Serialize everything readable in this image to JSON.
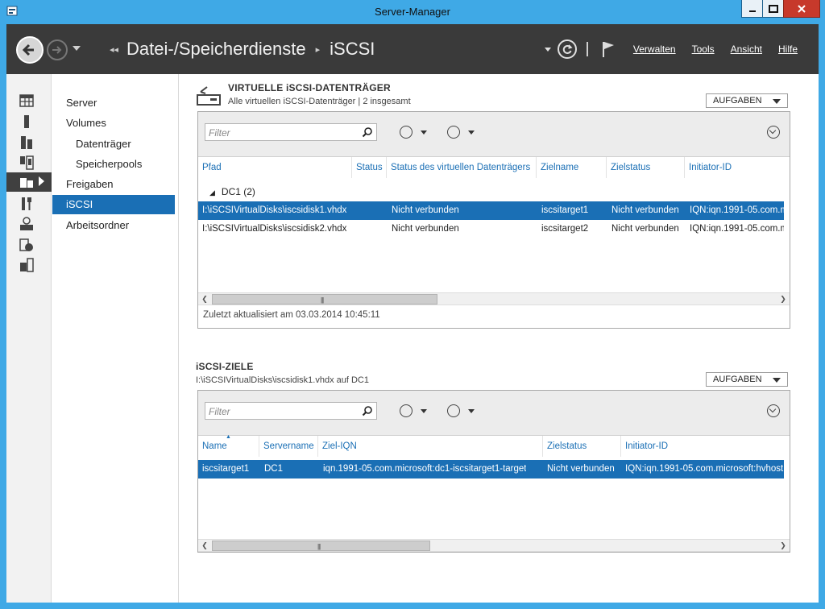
{
  "window": {
    "title": "Server-Manager"
  },
  "header": {
    "breadcrumb": [
      "Datei-/Speicherdienste",
      "iSCSI"
    ],
    "menu": [
      "Verwalten",
      "Tools",
      "Ansicht",
      "Hilfe"
    ]
  },
  "nav": {
    "items": [
      {
        "label": "Server",
        "sub": false,
        "selected": false
      },
      {
        "label": "Volumes",
        "sub": false,
        "selected": false
      },
      {
        "label": "Datenträger",
        "sub": true,
        "selected": false
      },
      {
        "label": "Speicherpools",
        "sub": true,
        "selected": false
      },
      {
        "label": "Freigaben",
        "sub": false,
        "selected": false
      },
      {
        "label": "iSCSI",
        "sub": false,
        "selected": true
      },
      {
        "label": "Arbeitsordner",
        "sub": false,
        "selected": false
      }
    ]
  },
  "disks": {
    "title": "VIRTUELLE iSCSI-DATENTRÄGER",
    "subtitle": "Alle virtuellen iSCSI-Datenträger | 2 insgesamt",
    "tasks_label": "AUFGABEN",
    "filter_placeholder": "Filter",
    "columns": [
      "Pfad",
      "Status",
      "Status des virtuellen Datenträgers",
      "Zielname",
      "Zielstatus",
      "Initiator-ID"
    ],
    "group": "DC1 (2)",
    "rows": [
      [
        "I:\\iSCSIVirtualDisks\\iscsidisk1.vhdx",
        "",
        "Nicht verbunden",
        "iscsitarget1",
        "Nicht verbunden",
        "IQN:iqn.1991-05.com.m"
      ],
      [
        "I:\\iSCSIVirtualDisks\\iscsidisk2.vhdx",
        "",
        "Nicht verbunden",
        "iscsitarget2",
        "Nicht verbunden",
        "IQN:iqn.1991-05.com.m"
      ]
    ],
    "last_updated": "Zuletzt aktualisiert am 03.03.2014 10:45:11"
  },
  "targets": {
    "title": "iSCSI-ZIELE",
    "subtitle": "I:\\iSCSIVirtualDisks\\iscsidisk1.vhdx auf DC1",
    "tasks_label": "AUFGABEN",
    "filter_placeholder": "Filter",
    "columns": [
      "Name",
      "Servername",
      "Ziel-IQN",
      "Zielstatus",
      "Initiator-ID"
    ],
    "rows": [
      [
        "iscsitarget1",
        "DC1",
        "iqn.1991-05.com.microsoft:dc1-iscsitarget1-target",
        "Nicht verbunden",
        "IQN:iqn.1991-05.com.microsoft:hvhost"
      ]
    ]
  },
  "colors": {
    "accent": "#1a6fb5",
    "header": "#3a3a3a",
    "frame": "#3fa9e6"
  },
  "icons": [
    "server-manager-icon",
    "dashboard-icon",
    "local-server-icon",
    "all-servers-icon",
    "file-storage-icon",
    "tools-icon",
    "web-server-icon",
    "backup-icon",
    "remote-access-icon"
  ]
}
